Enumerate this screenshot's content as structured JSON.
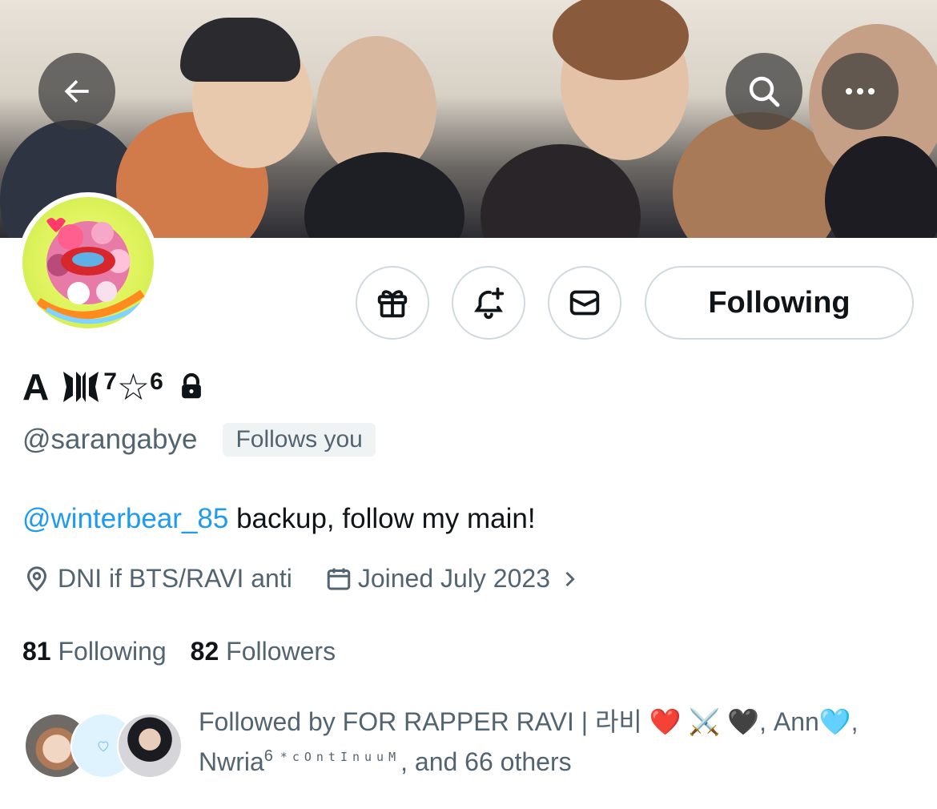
{
  "header": {
    "back_icon": "arrow-left-icon",
    "search_icon": "search-icon",
    "more_icon": "more-horizontal-icon"
  },
  "actions": {
    "gift_icon": "gift-icon",
    "notify_icon": "bell-plus-icon",
    "message_icon": "envelope-icon",
    "following_label": "Following"
  },
  "profile": {
    "name_prefix": "A",
    "name_sup1": "7",
    "name_star": "☆",
    "name_sup2": "6",
    "handle": "@sarangabye",
    "follows_you": "Follows you",
    "bio_mention": "@winterbear_85",
    "bio_text": " backup, follow my main!",
    "location": "DNI if BTS/RAVI anti",
    "joined": "Joined July 2023",
    "following_count": "81",
    "following_label": " Following",
    "followers_count": "82",
    "followers_label": " Followers"
  },
  "followed_by": {
    "prefix": "Followed by FOR RAPPER RAVI | 라비 ",
    "emojis1": "❤️ ⚔️ 🖤",
    "mid1": ", Ann",
    "emoji2": "🩵",
    "mid2": ",",
    "line2_name": "Nwria",
    "line2_sup": "6",
    "line2_small": "*cOntInuuM",
    "line2_end": ", and 66 others"
  },
  "colors": {
    "accent": "#1d9bf0",
    "secondary_text": "#536471",
    "border": "#cfd9de"
  }
}
